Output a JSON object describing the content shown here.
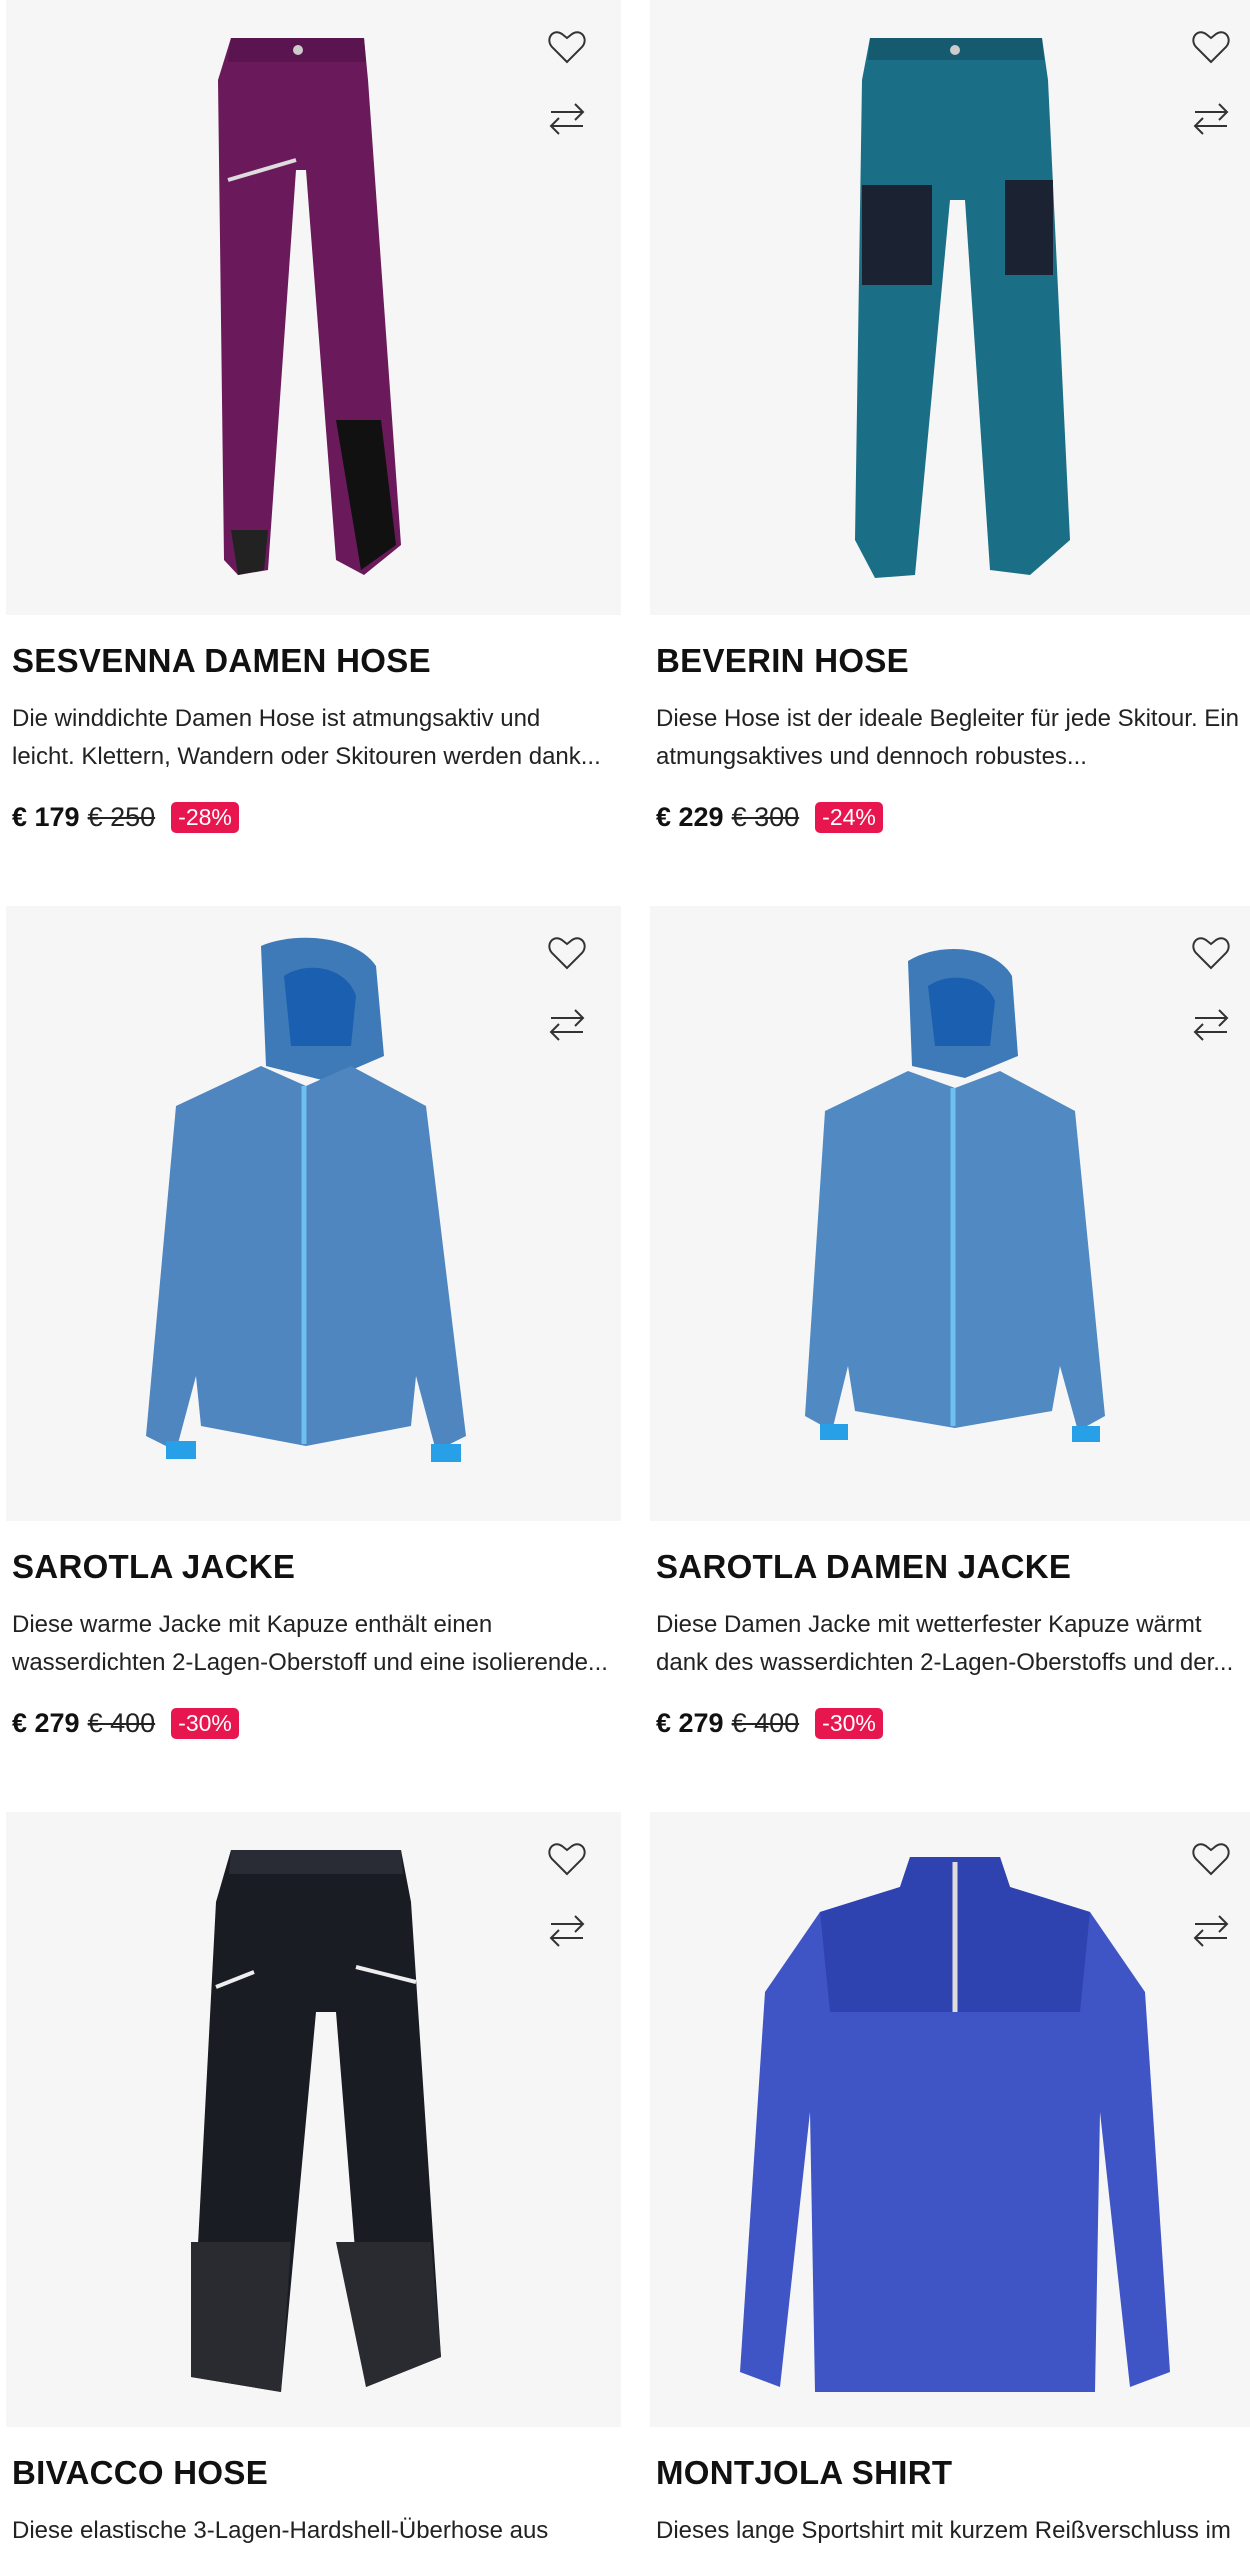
{
  "colors": {
    "badge": "#e8164f",
    "image_bg": "#f6f6f6"
  },
  "products": [
    {
      "title": "SESVENNA DAMEN HOSE",
      "desc1": "Die winddichte Damen Hose ist atmungsaktiv und",
      "desc2": "leicht. Klettern, Wandern oder Skitouren werden dank...",
      "price": "€ 179",
      "old_price": "€ 250",
      "discount": "-28%",
      "image": "purple-pants"
    },
    {
      "title": "BEVERIN HOSE",
      "desc1": "Diese Hose ist der ideale Begleiter für jede Skitour. Ein",
      "desc2": "atmungsaktives und dennoch robustes...",
      "price": "€ 229",
      "old_price": "€ 300",
      "discount": "-24%",
      "image": "teal-pants"
    },
    {
      "title": "SAROTLA JACKE",
      "desc1": "Diese warme Jacke mit Kapuze enthält einen",
      "desc2": "wasserdichten 2-Lagen-Oberstoff und eine isolierende...",
      "price": "€ 279",
      "old_price": "€ 400",
      "discount": "-30%",
      "image": "blue-jacket"
    },
    {
      "title": "SAROTLA DAMEN JACKE",
      "desc1": "Diese Damen Jacke mit wetterfester Kapuze wärmt",
      "desc2": "dank des wasserdichten 2-Lagen-Oberstoffs und der...",
      "price": "€ 279",
      "old_price": "€ 400",
      "discount": "-30%",
      "image": "blue-jacket-women"
    },
    {
      "title": "BIVACCO HOSE",
      "desc1": "Diese elastische 3-Lagen-Hardshell-Überhose aus",
      "desc2": "",
      "price": "",
      "old_price": "",
      "discount": "",
      "image": "black-pants"
    },
    {
      "title": "MONTJOLA SHIRT",
      "desc1": "Dieses lange Sportshirt mit kurzem Reißverschluss im",
      "desc2": "",
      "price": "",
      "old_price": "",
      "discount": "",
      "image": "blue-shirt"
    }
  ]
}
